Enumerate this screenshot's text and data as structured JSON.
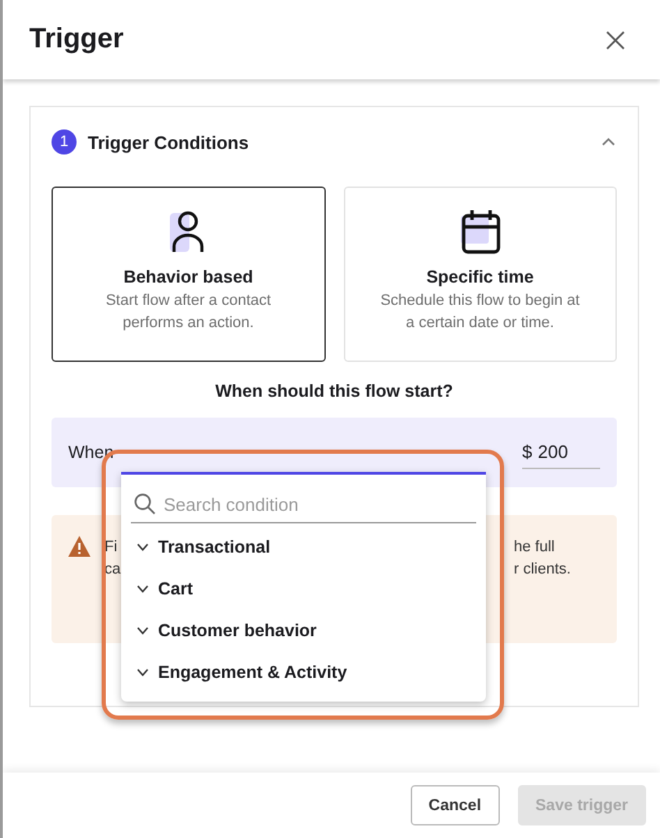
{
  "dialog": {
    "title": "Trigger"
  },
  "section": {
    "step": "1",
    "title": "Trigger Conditions",
    "expanded": true
  },
  "options": [
    {
      "kind": "person",
      "title": "Behavior based",
      "description": "Start flow after a contact performs an action.",
      "selected": true
    },
    {
      "kind": "calendar",
      "title": "Specific time",
      "description": "Schedule this flow to begin at a certain date or time.",
      "selected": false
    }
  ],
  "question": "When should this flow start?",
  "condition_row": {
    "label": "When",
    "currency": "$",
    "amount": "200"
  },
  "warning": {
    "left_lines": [
      "Fi",
      "ca"
    ],
    "right_lines": [
      "he full",
      "r clients."
    ]
  },
  "dropdown": {
    "placeholder": "Search condition",
    "groups": [
      {
        "label": "Transactional",
        "expanded": false
      },
      {
        "label": "Cart",
        "expanded": false
      },
      {
        "label": "Customer behavior",
        "expanded": false
      },
      {
        "label": "Engagement & Activity",
        "expanded": false
      }
    ]
  },
  "footer": {
    "buttons": [
      {
        "label": "Cancel",
        "disabled": false
      },
      {
        "label": "Save trigger",
        "disabled": true
      }
    ]
  }
}
